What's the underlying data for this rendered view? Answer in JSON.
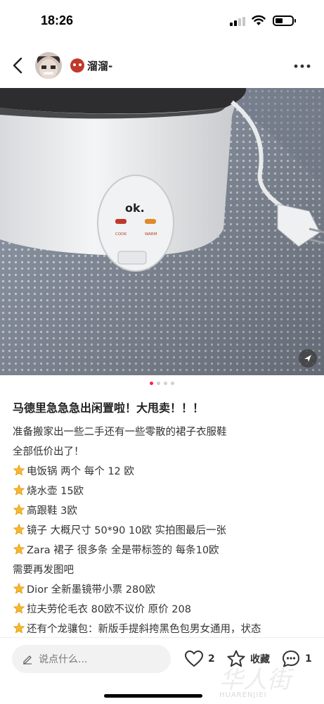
{
  "status_bar": {
    "time": "18:26"
  },
  "header": {
    "username": "溜溜-"
  },
  "carousel": {
    "total": 4,
    "active_index": 0
  },
  "post": {
    "title": "马德里急急急出闲置啦！大甩卖！！！",
    "lines": [
      {
        "star": false,
        "text": "准备搬家出一些二手还有一些零散的裙子衣服鞋"
      },
      {
        "star": false,
        "text": "全部低价出了！"
      },
      {
        "star": true,
        "text": "电饭锅 两个  每个 12 欧"
      },
      {
        "star": true,
        "text": "烧水壶 15欧"
      },
      {
        "star": true,
        "text": "高跟鞋 3欧"
      },
      {
        "star": true,
        "text": "镜子 大概尺寸 50*90  10欧 实拍图最后一张"
      },
      {
        "star": true,
        "text": "Zara 裙子 很多条 全是带标签的 每条10欧"
      },
      {
        "star": false,
        "text": "需要再发图吧"
      },
      {
        "star": true,
        "text": "Dior 全新墨镜带小票  280欧"
      },
      {
        "star": true,
        "text": "拉夫劳伦毛衣 80欧不议价 原价 208"
      },
      {
        "star": true,
        "text": "还有个龙骧包：新版手提斜挎黑色包男女通用，状态"
      }
    ]
  },
  "bottom_bar": {
    "comment_placeholder": "说点什么...",
    "like_count": "2",
    "collect_label": "收藏",
    "comment_count": "1"
  },
  "photo": {
    "brand_text": "ok.",
    "cook_label": "COOK",
    "warm_label": "WARM"
  },
  "watermark": {
    "text": "HUARENJIEI",
    "cn": "华人街"
  },
  "colors": {
    "accent": "#ff2442",
    "star": "#f5b82e"
  }
}
